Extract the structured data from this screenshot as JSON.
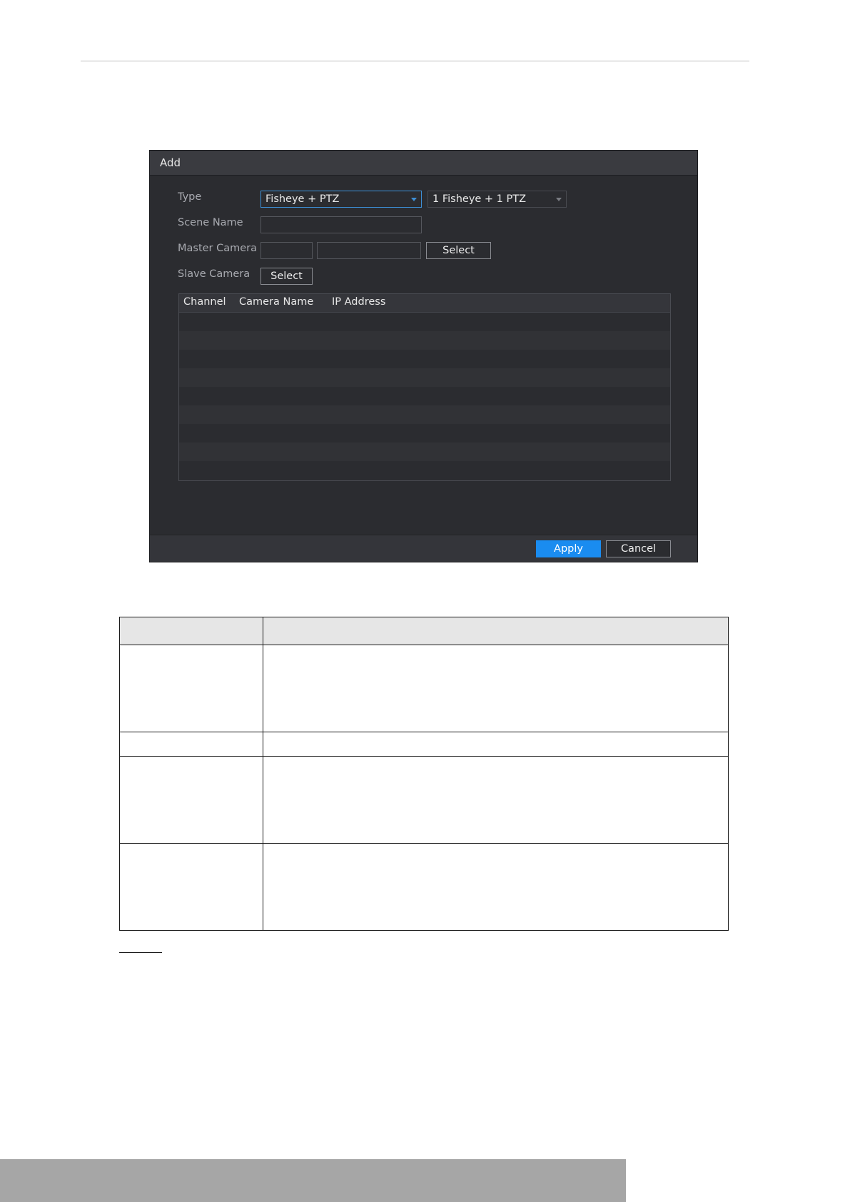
{
  "dialog": {
    "title": "Add",
    "type_label": "Type",
    "type_value": "Fisheye + PTZ",
    "mode_value": "1 Fisheye + 1 PTZ",
    "scene_name_label": "Scene Name",
    "scene_name_value": "",
    "master_camera_label": "Master Camera",
    "master_channel_value": "",
    "master_name_value": "",
    "master_select_label": "Select",
    "slave_camera_label": "Slave Camera",
    "slave_select_label": "Select",
    "table": {
      "columns": [
        "Channel",
        "Camera Name",
        "IP Address"
      ],
      "rows": []
    },
    "apply_label": "Apply",
    "cancel_label": "Cancel"
  },
  "colors": {
    "accent": "#1a8cf0",
    "dialog_bg": "#2b2c30",
    "header_bg": "#3a3b40"
  },
  "icons": {
    "type_dropdown": "chevron-down-icon",
    "mode_dropdown": "chevron-down-icon"
  }
}
